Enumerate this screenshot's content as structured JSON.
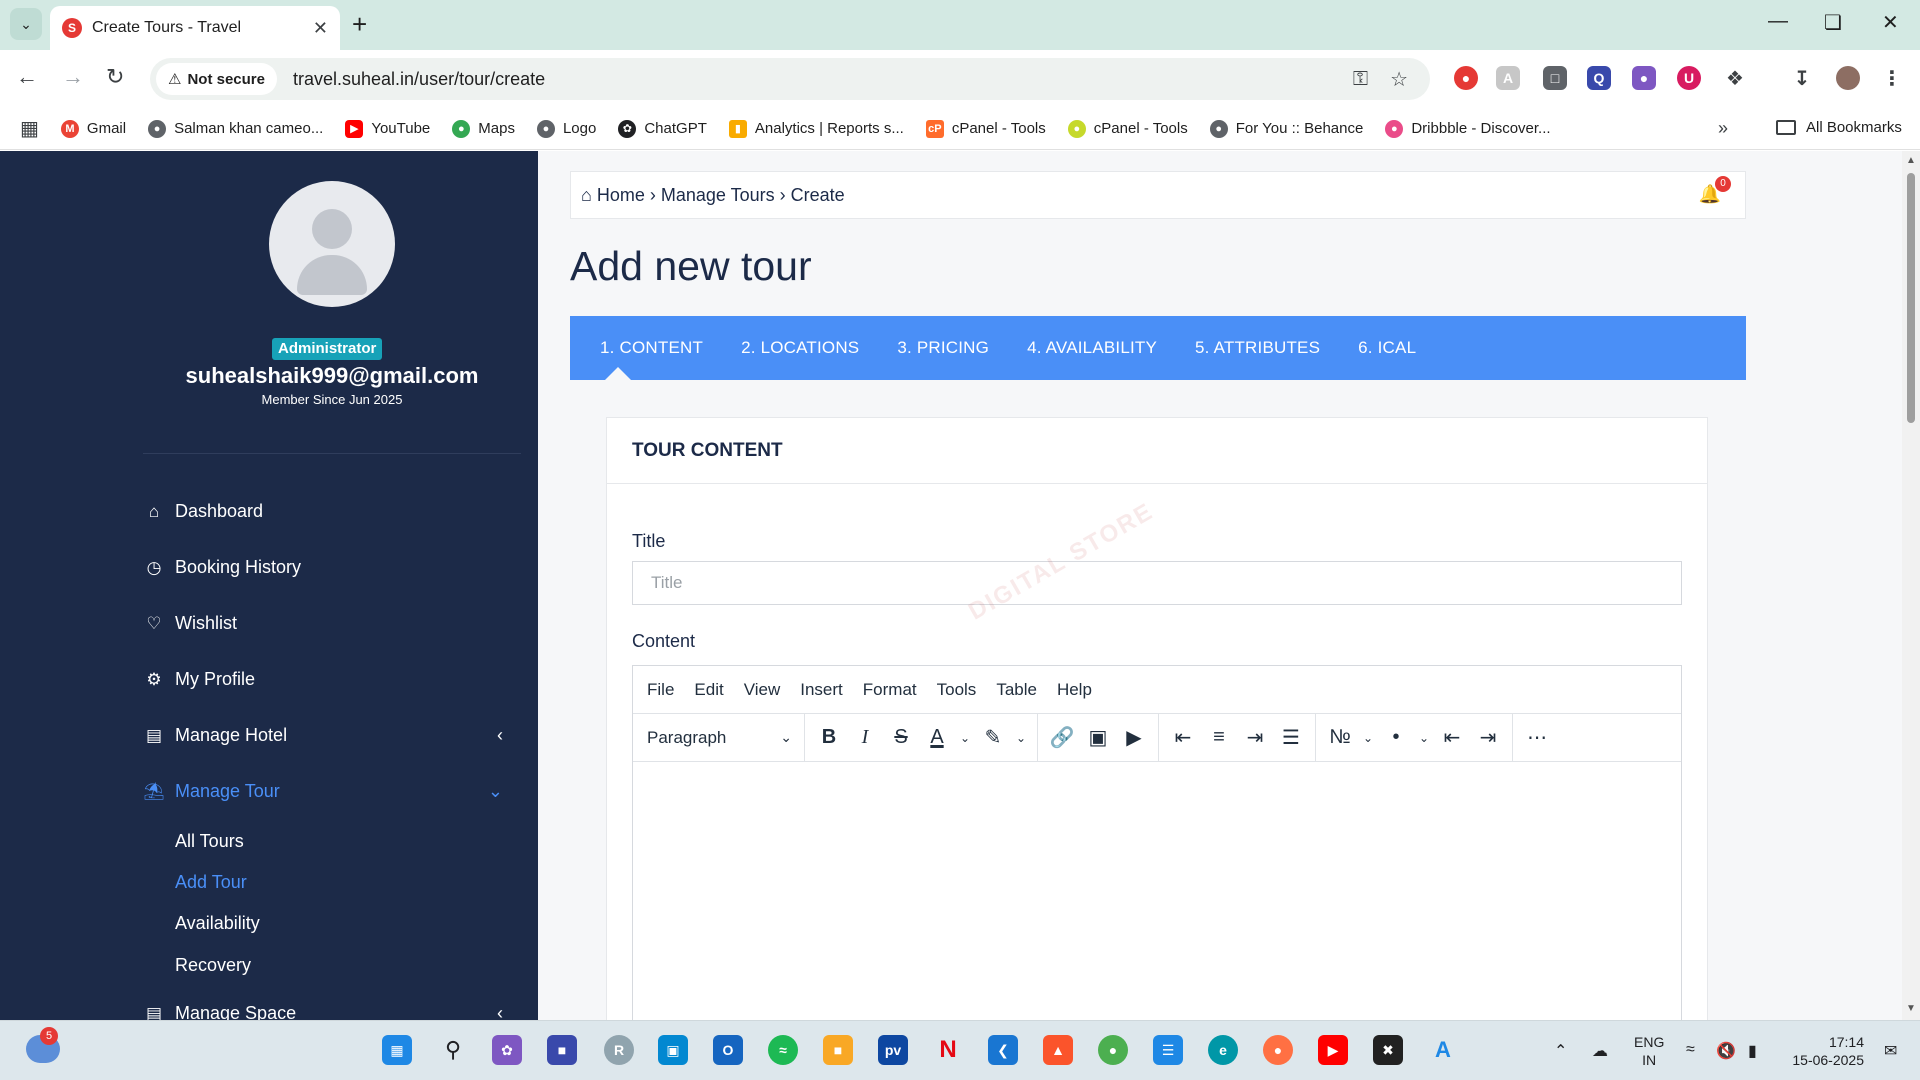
{
  "browser": {
    "tab_title": "Create Tours - Travel",
    "security_label": "Not secure",
    "url": "travel.suheal.in/user/tour/create",
    "bookmarks": [
      {
        "label": "Gmail",
        "color": "#ea4335"
      },
      {
        "label": "Salman khan cameo...",
        "color": "#5f6368"
      },
      {
        "label": "YouTube",
        "color": "#ff0000"
      },
      {
        "label": "Maps",
        "color": "#34a853"
      },
      {
        "label": "Logo",
        "color": "#5f6368"
      },
      {
        "label": "ChatGPT",
        "color": "#202124"
      },
      {
        "label": "Analytics | Reports s...",
        "color": "#f9ab00"
      },
      {
        "label": "cPanel - Tools",
        "color": "#ff6c2c"
      },
      {
        "label": "cPanel - Tools",
        "color": "#c6d92b"
      },
      {
        "label": "For You :: Behance",
        "color": "#5f6368"
      },
      {
        "label": "Dribbble - Discover...",
        "color": "#ea4c89"
      }
    ],
    "all_bookmarks": "All Bookmarks"
  },
  "sidebar": {
    "role": "Administrator",
    "email": "suhealshaik999@gmail.com",
    "member_since": "Member Since Jun 2025",
    "menu": [
      {
        "label": "Dashboard",
        "icon": "home-icon"
      },
      {
        "label": "Booking History",
        "icon": "clock-icon"
      },
      {
        "label": "Wishlist",
        "icon": "heart-icon"
      },
      {
        "label": "My Profile",
        "icon": "cogs-icon"
      },
      {
        "label": "Manage Hotel",
        "icon": "building-icon"
      },
      {
        "label": "Manage Tour",
        "icon": "beach-icon"
      },
      {
        "label": "Manage Space",
        "icon": "building-icon"
      }
    ],
    "tour_submenu": [
      {
        "label": "All Tours"
      },
      {
        "label": "Add Tour"
      },
      {
        "label": "Availability"
      },
      {
        "label": "Recovery"
      }
    ]
  },
  "breadcrumb": {
    "home": "Home",
    "manage": "Manage Tours",
    "current": "Create"
  },
  "notifications": {
    "count": "0"
  },
  "page": {
    "title": "Add new tour",
    "steps": [
      "1. CONTENT",
      "2. LOCATIONS",
      "3. PRICING",
      "4. AVAILABILITY",
      "5. ATTRIBUTES",
      "6. ICAL"
    ]
  },
  "form": {
    "panel_title": "TOUR CONTENT",
    "title_label": "Title",
    "title_placeholder": "Title",
    "title_value": "",
    "content_label": "Content",
    "watermark": "DIGITAL STORE"
  },
  "editor": {
    "menus": [
      "File",
      "Edit",
      "View",
      "Insert",
      "Format",
      "Tools",
      "Table",
      "Help"
    ],
    "block_format": "Paragraph"
  },
  "taskbar": {
    "weather_badge": "5",
    "lang_line1": "ENG",
    "lang_line2": "IN",
    "time": "17:14",
    "date": "15-06-2025"
  },
  "colors": {
    "sidebar_bg": "#1c2a48",
    "accent": "#4a8ff7",
    "badge": "#17a2b8"
  }
}
